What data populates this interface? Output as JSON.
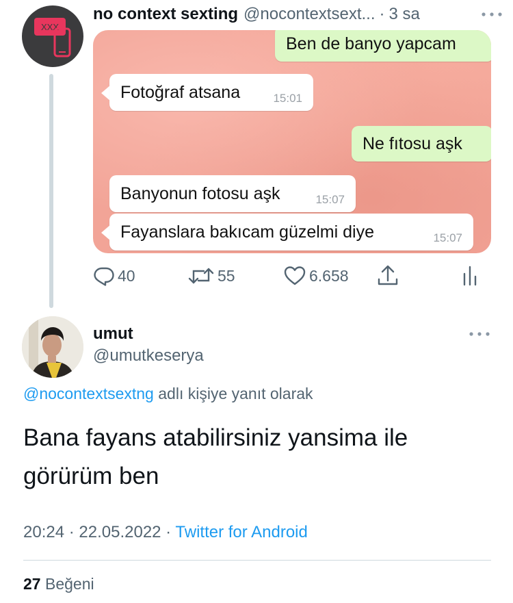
{
  "parent_tweet": {
    "author_name": "no context sexting",
    "handle": "@nocontextsext...",
    "separator": "·",
    "time_ago": "3 sa",
    "avatar_badge": "XXX",
    "media_chat": [
      {
        "text": "Ben de banyo yapcam",
        "direction": "out",
        "time": ""
      },
      {
        "text": "Fotoğraf atsana",
        "direction": "in",
        "time": "15:01"
      },
      {
        "text": "Ne fıtosu aşk",
        "direction": "out",
        "time": ""
      },
      {
        "text": "Banyonun fotosu aşk",
        "direction": "in",
        "time": "15:07"
      },
      {
        "text": "Fayanslara bakıcam güzelmi diye",
        "direction": "in",
        "time": "15:07"
      }
    ],
    "actions": {
      "reply_count": "40",
      "retweet_count": "55",
      "like_count": "6.658"
    }
  },
  "main_tweet": {
    "author_name": "umut",
    "handle": "@umutkeserya",
    "replying_to_handle": "@nocontextsextng",
    "replying_to_suffix": " adlı kişiye yanıt olarak",
    "text_line1": "Bana fayans atabilirsiniz yansima ile",
    "text_line2": "görürüm ben",
    "time": "20:24",
    "meta_separator": " · ",
    "date": "22.05.2022",
    "source": "Twitter for Android",
    "like_count": "27",
    "like_label": " Beğeni"
  },
  "colors": {
    "link": "#1d9bf0",
    "secondary_text": "#536471",
    "media_background": "#f2a497",
    "outgoing_bubble": "#dcf8c6",
    "badge": "#e8365d"
  }
}
